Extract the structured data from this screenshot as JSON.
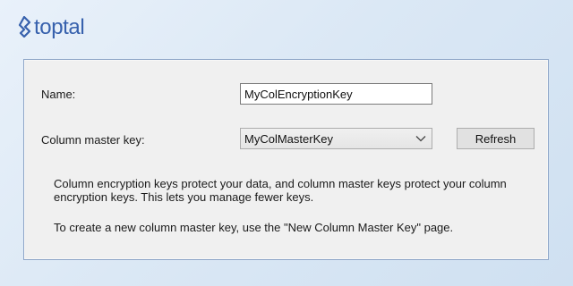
{
  "brand": {
    "logo_text": "toptal",
    "color": "#3761ad"
  },
  "form": {
    "name_label": "Name:",
    "name_value": "MyColEncryptionKey",
    "cmk_label": "Column master key:",
    "cmk_selected": "MyColMasterKey",
    "refresh_label": "Refresh"
  },
  "help": {
    "paragraph1": "Column encryption keys protect your data, and column master keys protect your column encryption keys. This lets you manage fewer keys.",
    "paragraph2": "To create a new column master key, use the \"New Column Master Key\" page."
  },
  "icons": {
    "logo": "toptal-logo-icon",
    "dropdown": "chevron-down-icon"
  }
}
